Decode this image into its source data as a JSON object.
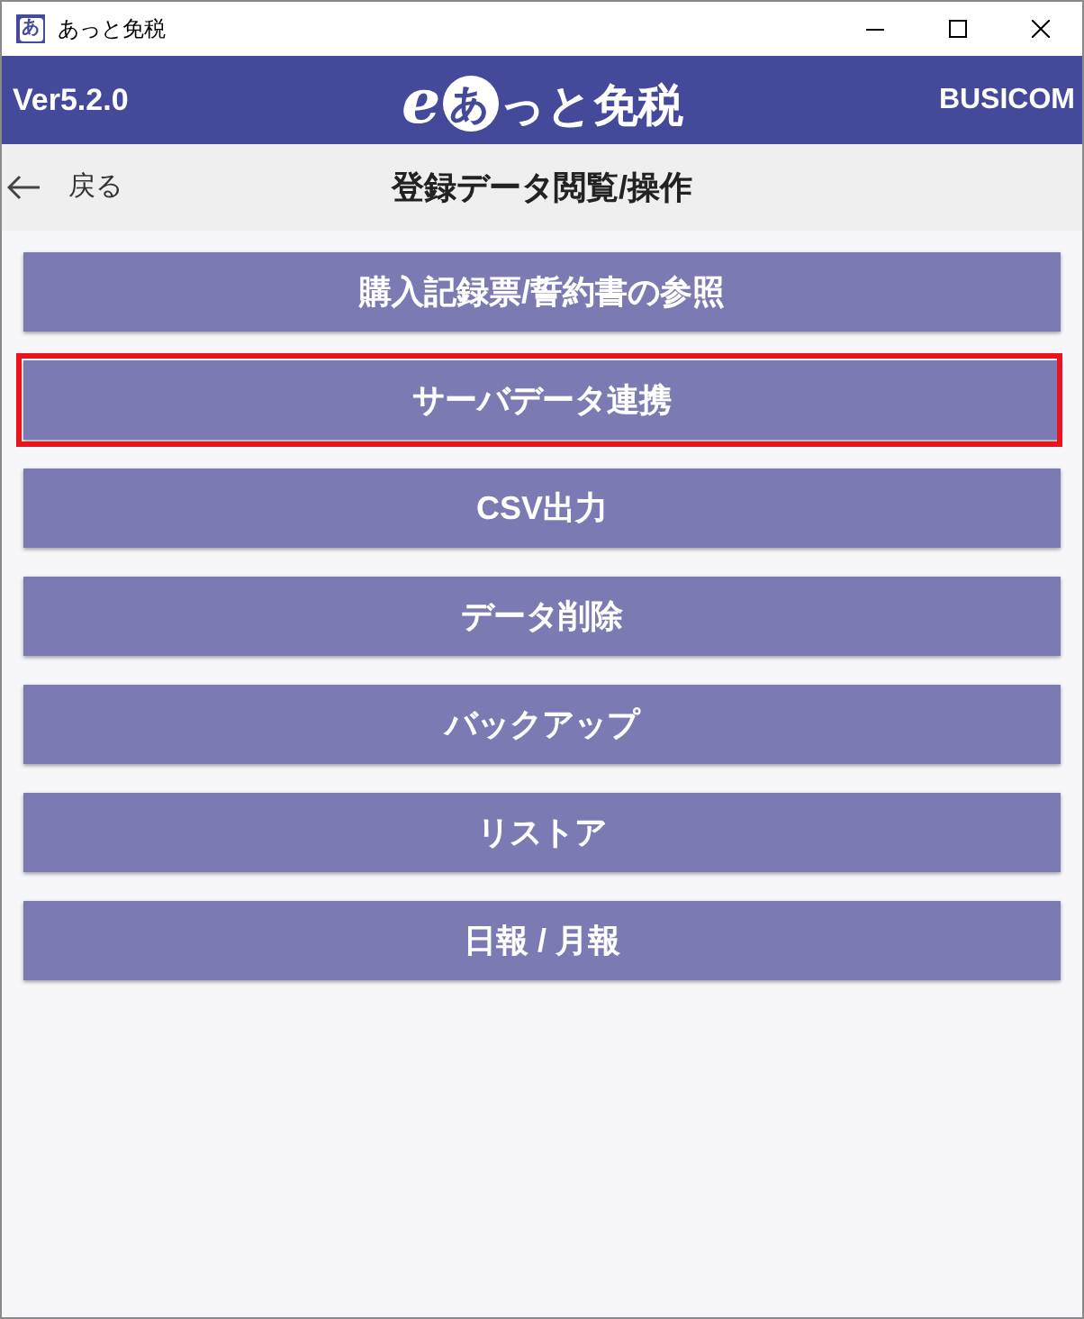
{
  "window": {
    "title": "あっと免税",
    "app_icon": "あ"
  },
  "header": {
    "version": "Ver5.2.0",
    "logo": {
      "prefix": "e",
      "badge": "あ",
      "text": "っと免税"
    },
    "company": "BUSICOM"
  },
  "toolbar": {
    "back": "戻る",
    "title": "登録データ閲覧/操作"
  },
  "menu": [
    {
      "label": "購入記録票/誓約書の参照",
      "highlighted": false
    },
    {
      "label": "サーバデータ連携",
      "highlighted": true
    },
    {
      "label": "CSV出力",
      "highlighted": false
    },
    {
      "label": "データ削除",
      "highlighted": false
    },
    {
      "label": "バックアップ",
      "highlighted": false
    },
    {
      "label": "リストア",
      "highlighted": false
    },
    {
      "label": "日報 / 月報",
      "highlighted": false
    }
  ]
}
